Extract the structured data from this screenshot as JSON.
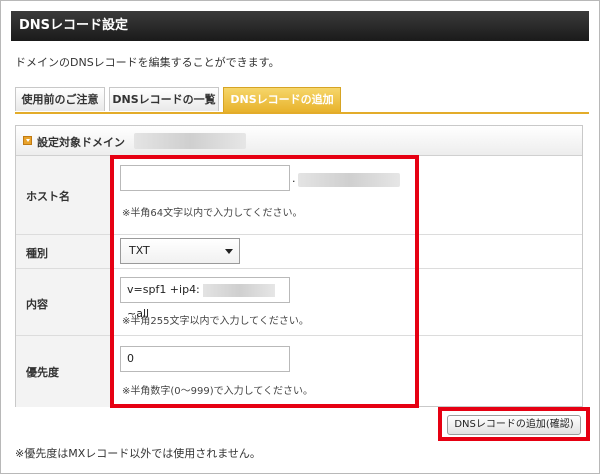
{
  "window": {
    "title": "DNSレコード設定"
  },
  "description": "ドメインのDNSレコードを編集することができます。",
  "tabs": [
    {
      "label": "使用前のご注意",
      "active": false
    },
    {
      "label": "DNSレコードの一覧",
      "active": false
    },
    {
      "label": "DNSレコードの追加",
      "active": true
    }
  ],
  "section": {
    "title": "設定対象ドメイン"
  },
  "form": {
    "host": {
      "label": "ホスト名",
      "value": "",
      "dot": ".",
      "note": "※半角64文字以内で入力してください。"
    },
    "type": {
      "label": "種別",
      "selected": "TXT"
    },
    "content": {
      "label": "内容",
      "value_prefix": "v=spf1 +ip4:",
      "value_suffix": "~all",
      "note": "※半角255文字以内で入力してください。"
    },
    "priority": {
      "label": "優先度",
      "value": "0",
      "note": "※半角数字(0〜999)で入力してください。"
    }
  },
  "submit_label": "DNSレコードの追加(確認)",
  "footnote": "※優先度はMXレコード以外では使用されません。",
  "colors": {
    "accent": "#e7b129",
    "highlight": "#e60012",
    "titlebar": "#1a1a1a"
  }
}
